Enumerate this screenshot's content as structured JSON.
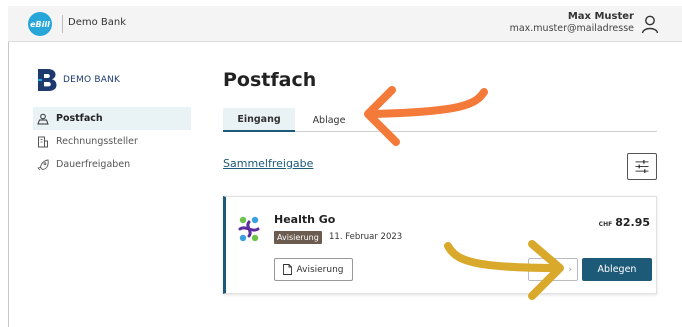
{
  "topbar": {
    "logo_text": "eBill",
    "bank_name": "Demo Bank",
    "user_name": "Max Muster",
    "user_email": "max.muster@mailadresse"
  },
  "sidebar": {
    "bank_logo_text": "DEMO BANK",
    "items": [
      {
        "label": "Postfach",
        "icon": "inbox-person-icon",
        "active": true
      },
      {
        "label": "Rechnungssteller",
        "icon": "building-icon",
        "active": false
      },
      {
        "label": "Dauerfreigaben",
        "icon": "rocket-icon",
        "active": false
      }
    ]
  },
  "main": {
    "title": "Postfach",
    "tabs": [
      {
        "label": "Eingang",
        "active": true
      },
      {
        "label": "Ablage",
        "active": false
      }
    ],
    "bulk_link": "Sammelfreigabe",
    "bill": {
      "biller": "Health Go",
      "tag": "Avisierung",
      "date": "11. Februar 2023",
      "currency": "CHF",
      "amount": "82.95",
      "avis_button": "Avisierung",
      "more_button_chevron": "›",
      "archive_button": "Ablegen"
    }
  },
  "colors": {
    "accent": "#1d5a78",
    "ebill_blue": "#27a6d9",
    "tag_brown": "#6b5c4f",
    "annotation_orange": "#f47a3a",
    "annotation_gold": "#d9a92c"
  }
}
